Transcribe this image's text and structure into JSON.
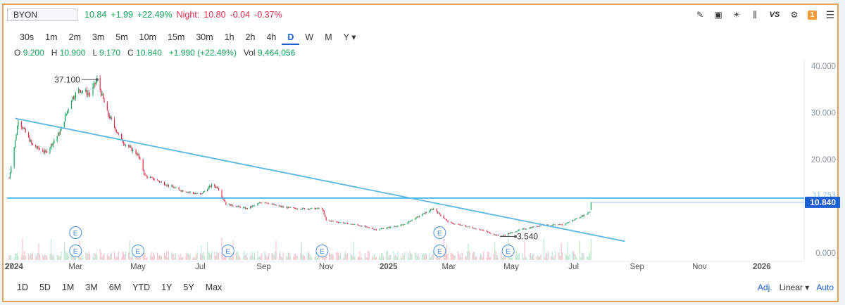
{
  "header": {
    "symbol": "BYON",
    "last": "10.84",
    "change": "+1.99",
    "change_pct": "+22.49%",
    "night_label": "Night:",
    "night_price": "10.80",
    "night_change": "-0.04",
    "night_change_pct": "-0.37%"
  },
  "toolbar_icons": [
    "pencil-icon",
    "chart-icon",
    "lightbulb-icon",
    "candles-icon",
    "compare-vs-icon",
    "settings-icon",
    "alert-badge-icon",
    "menu-icon"
  ],
  "toolbar": {
    "vs_label": "VS",
    "alert_count": "1"
  },
  "periods": [
    "30s",
    "1m",
    "2m",
    "3m",
    "5m",
    "10m",
    "15m",
    "30m",
    "1h",
    "2h",
    "4h",
    "D",
    "W",
    "M",
    "Y ▾"
  ],
  "active_period": "D",
  "ohlc": {
    "o_label": "O",
    "o": "9.200",
    "h_label": "H",
    "h": "10.900",
    "l_label": "L",
    "l": "9.170",
    "c_label": "C",
    "c": "10.840",
    "chg": "+1.990 (+22.49%)",
    "vol_label": "Vol",
    "vol": "9,464,056"
  },
  "ranges": [
    "1D",
    "5D",
    "1M",
    "3M",
    "6M",
    "YTD",
    "1Y",
    "5Y",
    "Max"
  ],
  "scale": {
    "adj": "Adj.",
    "linear": "Linear ▾",
    "auto": "Auto"
  },
  "chart_data": {
    "type": "line",
    "ticker": "BYON",
    "x_ticks": [
      "27",
      "2024",
      "Mar",
      "May",
      "Jul",
      "Sep",
      "Nov",
      "2025",
      "Mar",
      "May",
      "Jul",
      "Sep",
      "Nov",
      "2026"
    ],
    "y_ticks": [
      "40.000",
      "30.000",
      "20.000",
      "0.000"
    ],
    "ylim": [
      0,
      42
    ],
    "price_path": [
      [
        "2023-12-27",
        16.0
      ],
      [
        "2024-01-02",
        24.0
      ],
      [
        "2024-01-05",
        28.5
      ],
      [
        "2024-01-19",
        23.0
      ],
      [
        "2024-02-01",
        21.5
      ],
      [
        "2024-02-15",
        26.0
      ],
      [
        "2024-02-26",
        33.0
      ],
      [
        "2024-03-05",
        35.0
      ],
      [
        "2024-03-15",
        34.0
      ],
      [
        "2024-03-22",
        37.1
      ],
      [
        "2024-04-01",
        30.0
      ],
      [
        "2024-04-15",
        24.0
      ],
      [
        "2024-05-01",
        21.0
      ],
      [
        "2024-05-08",
        16.5
      ],
      [
        "2024-05-20",
        15.5
      ],
      [
        "2024-06-10",
        13.5
      ],
      [
        "2024-07-01",
        12.5
      ],
      [
        "2024-07-12",
        14.5
      ],
      [
        "2024-07-18",
        14.0
      ],
      [
        "2024-07-26",
        10.5
      ],
      [
        "2024-08-15",
        9.5
      ],
      [
        "2024-09-01",
        11.0
      ],
      [
        "2024-09-15",
        10.0
      ],
      [
        "2024-10-01",
        9.5
      ],
      [
        "2024-10-28",
        9.5
      ],
      [
        "2024-11-01",
        7.0
      ],
      [
        "2024-12-01",
        6.0
      ],
      [
        "2024-12-20",
        5.0
      ],
      [
        "2025-01-15",
        6.0
      ],
      [
        "2025-02-05",
        8.5
      ],
      [
        "2025-02-14",
        9.5
      ],
      [
        "2025-03-01",
        6.5
      ],
      [
        "2025-04-01",
        5.0
      ],
      [
        "2025-04-20",
        3.54
      ],
      [
        "2025-05-10",
        5.0
      ],
      [
        "2025-06-01",
        6.0
      ],
      [
        "2025-06-20",
        6.0
      ],
      [
        "2025-07-10",
        8.0
      ],
      [
        "2025-07-17",
        8.85
      ],
      [
        "2025-07-18",
        10.84
      ]
    ],
    "horizontal_line": 11.753,
    "horizontal_line_label": "11.753",
    "last_price": 10.84,
    "last_price_label": "10.840",
    "trendline": [
      [
        "2024-01-02",
        28.8
      ],
      [
        "2025-08-20",
        2.5
      ]
    ],
    "annotations": [
      {
        "label": "37.100",
        "date": "2024-03-22",
        "value": 37.1
      },
      {
        "label": "3.540",
        "date": "2025-04-20",
        "value": 3.54
      }
    ],
    "earnings_markers": [
      "2024-03-01",
      "2024-05-01",
      "2024-07-28",
      "2024-10-28",
      "2025-02-20",
      "2025-04-28"
    ],
    "earnings_markers_upper": [
      "2024-03-01",
      "2025-02-20"
    ],
    "earnings_label": "E",
    "colors": {
      "up": "#18a35a",
      "down": "#e0304d",
      "trendline": "#5ab6e3",
      "hline": "#3aaee0",
      "last_tag": "#1a5fd6"
    }
  }
}
